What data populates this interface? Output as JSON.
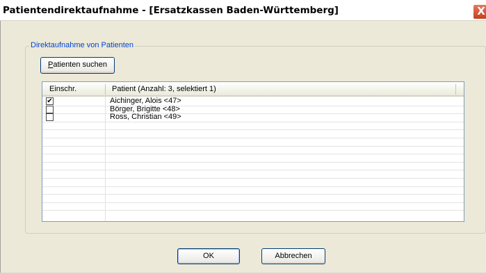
{
  "window": {
    "title": "Patientendirektaufnahme - [Ersatzkassen Baden-Württemberg]",
    "close_glyph": "X"
  },
  "group": {
    "legend": "Direktaufnahme von Patienten",
    "search_button_mnemonic": "P",
    "search_button_rest": "atienten suchen"
  },
  "list": {
    "headers": [
      "Einschr.",
      "Patient (Anzahl: 3, selektiert 1)"
    ],
    "rows": [
      {
        "checked": true,
        "check_glyph": "✔",
        "name": "Aichinger,  Alois <47>"
      },
      {
        "checked": false,
        "check_glyph": "",
        "name": "Börger,  Brigitte <48>"
      },
      {
        "checked": false,
        "check_glyph": "",
        "name": "Ross,  Christian <49>"
      }
    ]
  },
  "buttons": {
    "ok": "OK",
    "cancel": "Abbrechen"
  }
}
